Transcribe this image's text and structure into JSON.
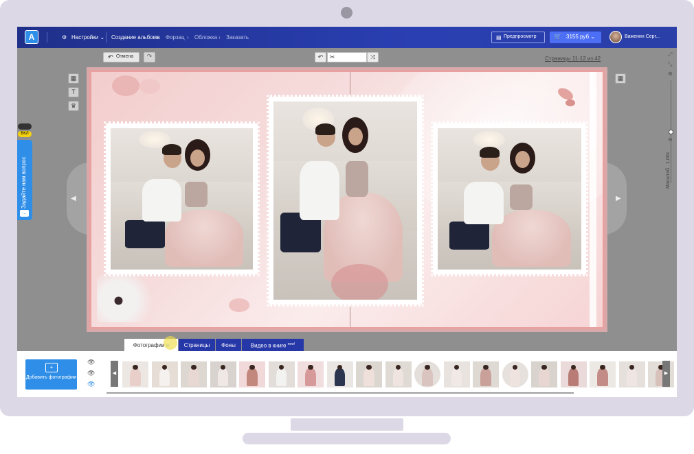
{
  "topbar": {
    "logo": "A",
    "settings": "Настройки",
    "steps": [
      "Создание альбома",
      "Форзац",
      "Обложка",
      "Заказать"
    ],
    "preview": "Предпросмотр",
    "price": "3155 руб",
    "user": "Важенин Серг..."
  },
  "toolbar": {
    "undo": "Отмена",
    "pages": "Страницы 11-12 из 42"
  },
  "side": {
    "feedback": "Задайте нам вопрос",
    "toggle_label": "ВКЛ"
  },
  "zoom": {
    "label": "Масштаб",
    "value": "1.00x"
  },
  "tabs": [
    {
      "label": "Фотографии",
      "arrow": "»"
    },
    {
      "label": "Страницы"
    },
    {
      "label": "Фоны"
    },
    {
      "label": "Видео в книге",
      "badge": "new!"
    }
  ],
  "panel": {
    "add_photos": "Добавить фотографии"
  },
  "colors": {
    "accent": "#2f8ee8",
    "topbar": "#2a3fb2",
    "price": "#4d6ff5",
    "tab": "#2637a8",
    "spread_border": "#e8a1a1"
  },
  "icons": {
    "logo": "a-logo-icon",
    "settings": "sliders-icon",
    "preview": "preview-icon",
    "cart": "cart-icon",
    "undo": "undo-icon",
    "redo": "redo-icon",
    "shuffle": "shuffle-icon"
  }
}
